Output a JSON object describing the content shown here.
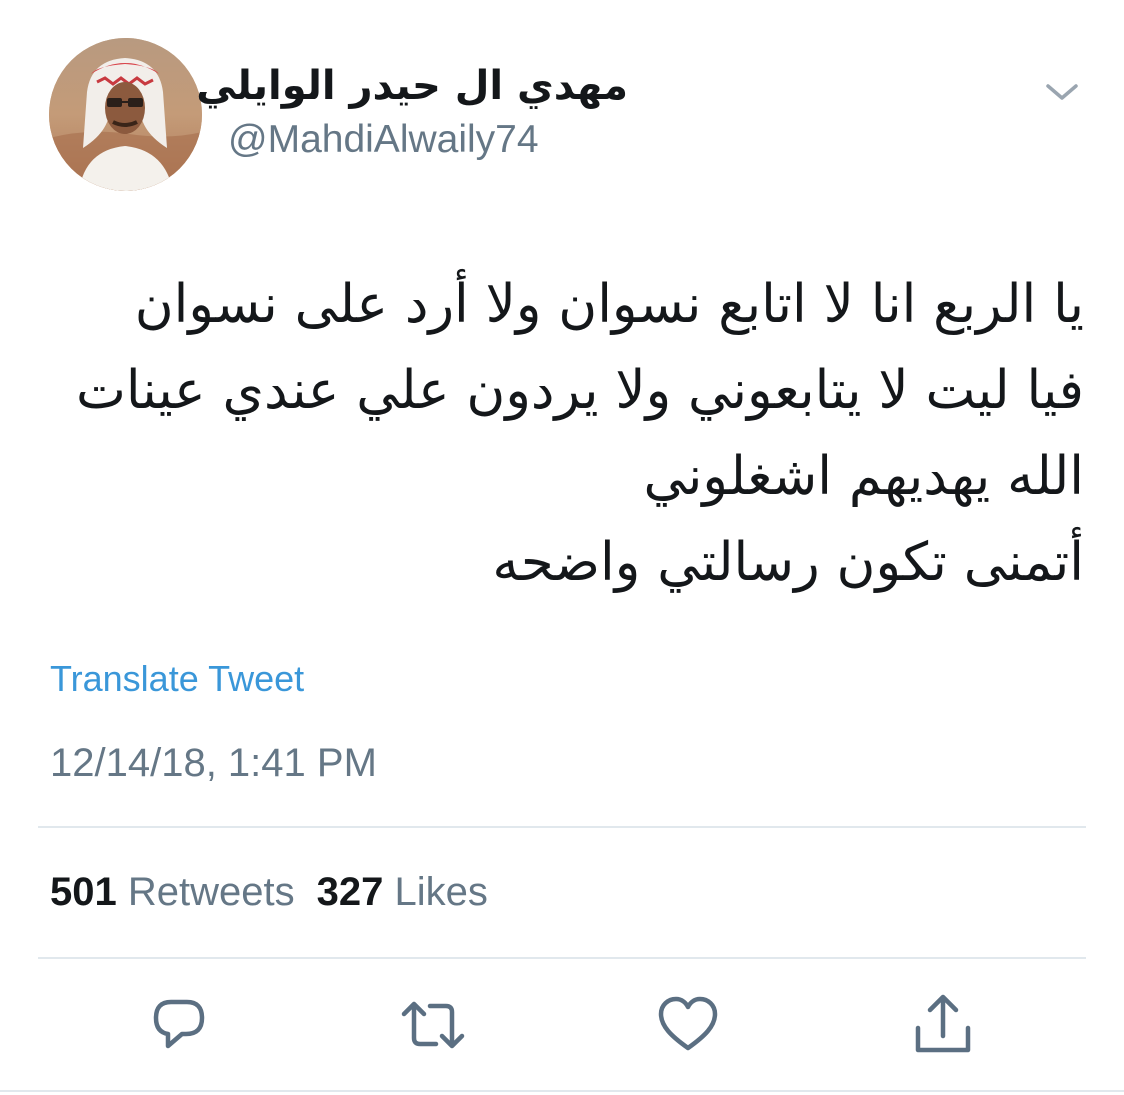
{
  "tweet": {
    "author": {
      "display_name": "مهدي ال حيدر الوايلي",
      "handle": "@MahdiAlwaily74"
    },
    "text_lines": [
      "يا الربع انا لا اتابع نسوان ولا أرد على نسوان",
      "فيا ليت لا يتابعوني ولا يردون علي عندي عينات",
      "الله يهديهم اشغلوني",
      "أتمنى تكون رسالتي واضحه"
    ],
    "translate_label": "Translate Tweet",
    "timestamp": "12/14/18, 1:41 PM",
    "stats": {
      "retweets_count": "501",
      "retweets_label": "Retweets",
      "likes_count": "327",
      "likes_label": "Likes"
    }
  },
  "actions": {
    "icons": [
      "reply-icon",
      "retweet-icon",
      "like-icon",
      "share-icon"
    ]
  },
  "colors": {
    "text": "#14171a",
    "secondary": "#657786",
    "link": "#3a97d9",
    "divider": "#e1e8ed",
    "icon": "#5b6f82"
  }
}
